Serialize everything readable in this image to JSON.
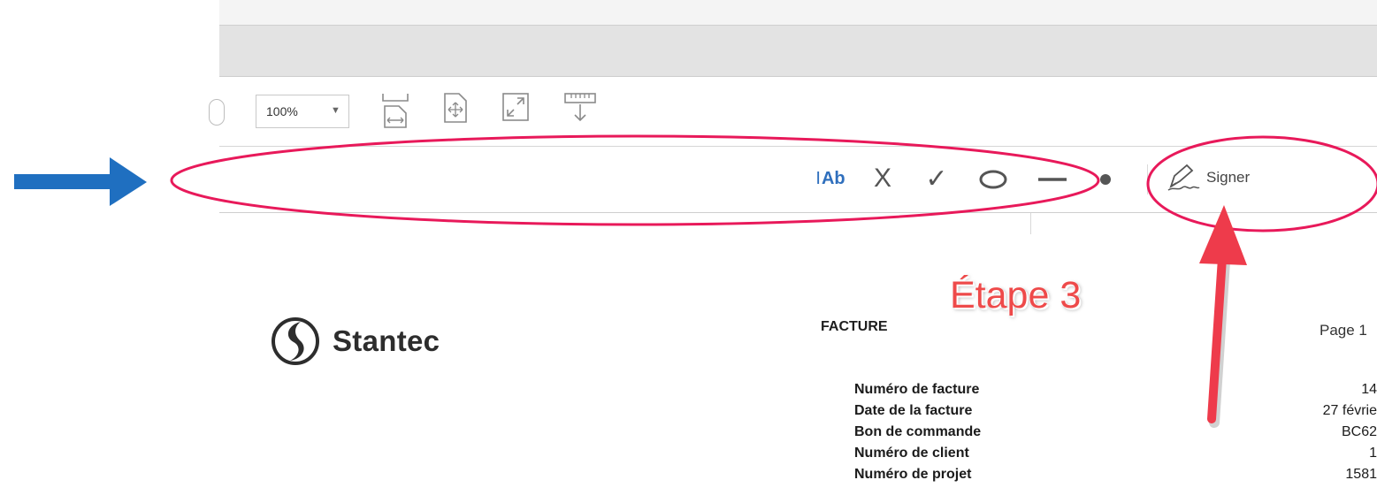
{
  "toolbar": {
    "zoom_value": "100%",
    "icons": [
      "fit-page-icon",
      "full-screen-icon",
      "expand-icon",
      "measure-tool-icon"
    ]
  },
  "fill_sign_bar": {
    "text_tool_label": "Ab",
    "cross_tool_glyph": "X",
    "check_tool_glyph": "✓",
    "sign_label": "Signer"
  },
  "annotations": {
    "step_label": "Étape 3",
    "highlight_color": "#e8195a",
    "pointer_arrow_color": "#ee3b4b",
    "side_arrow_color": "#1f6fc0"
  },
  "document": {
    "logo_text": "Stantec",
    "title": "FACTURE",
    "page_label": "Page 1",
    "fields": [
      {
        "label": "Numéro de facture",
        "value": "14"
      },
      {
        "label": "Date de la facture",
        "value": "27 févrie"
      },
      {
        "label": "Bon de commande",
        "value": "BC62"
      },
      {
        "label": "Numéro de client",
        "value": "1"
      },
      {
        "label": "Numéro de projet",
        "value": "1581"
      }
    ]
  }
}
